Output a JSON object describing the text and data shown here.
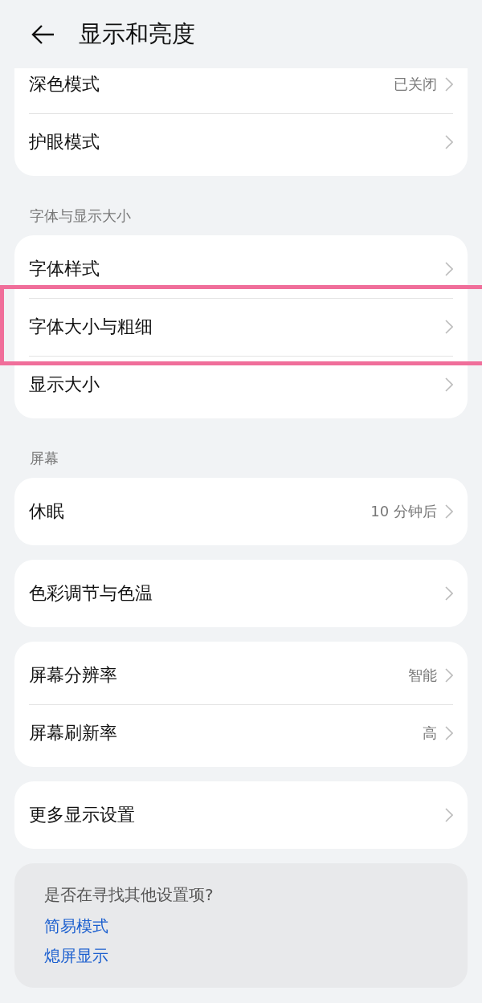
{
  "header": {
    "title": "显示和亮度"
  },
  "groups": [
    {
      "clipped": true,
      "items": [
        {
          "label": "深色模式",
          "value": "已关闭",
          "highlighted": false
        },
        {
          "label": "护眼模式",
          "highlighted": false
        }
      ]
    },
    {
      "title": "字体与显示大小",
      "items": [
        {
          "label": "字体样式",
          "highlighted": false
        },
        {
          "label": "字体大小与粗细",
          "highlighted": true
        },
        {
          "label": "显示大小",
          "highlighted": false
        }
      ]
    },
    {
      "title": "屏幕",
      "items": [
        {
          "label": "休眠",
          "value": "10 分钟后",
          "highlighted": false
        }
      ]
    },
    {
      "items": [
        {
          "label": "色彩调节与色温",
          "highlighted": false
        }
      ]
    },
    {
      "items": [
        {
          "label": "屏幕分辨率",
          "value": "智能",
          "highlighted": false
        },
        {
          "label": "屏幕刷新率",
          "value": "高",
          "highlighted": false
        }
      ]
    },
    {
      "items": [
        {
          "label": "更多显示设置",
          "highlighted": false
        }
      ]
    }
  ],
  "suggestions": {
    "title": "是否在寻找其他设置项?",
    "links": [
      "简易模式",
      "熄屏显示"
    ]
  }
}
